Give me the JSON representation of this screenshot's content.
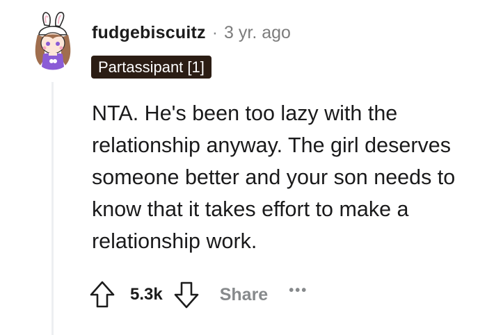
{
  "comment": {
    "author": "fudgebiscuitz",
    "separator": "·",
    "timestamp": "3 yr. ago",
    "flair": "Partassipant [1]",
    "body": "NTA. He's been too lazy with the relationship anyway. The girl deserves someone better and your son needs to know that it takes effort to make a relationship work.",
    "score": "5.3k",
    "share_label": "Share",
    "more_label": "•••",
    "avatar_icon": "bunny-hat-avatar-icon",
    "upvote_icon": "upvote-arrow-icon",
    "downvote_icon": "downvote-arrow-icon"
  },
  "colors": {
    "flair_background": "#2b1d14",
    "meta_gray": "#878a8c",
    "thread_line": "#edeff1",
    "avatar_accent": "#8b5cd6"
  }
}
